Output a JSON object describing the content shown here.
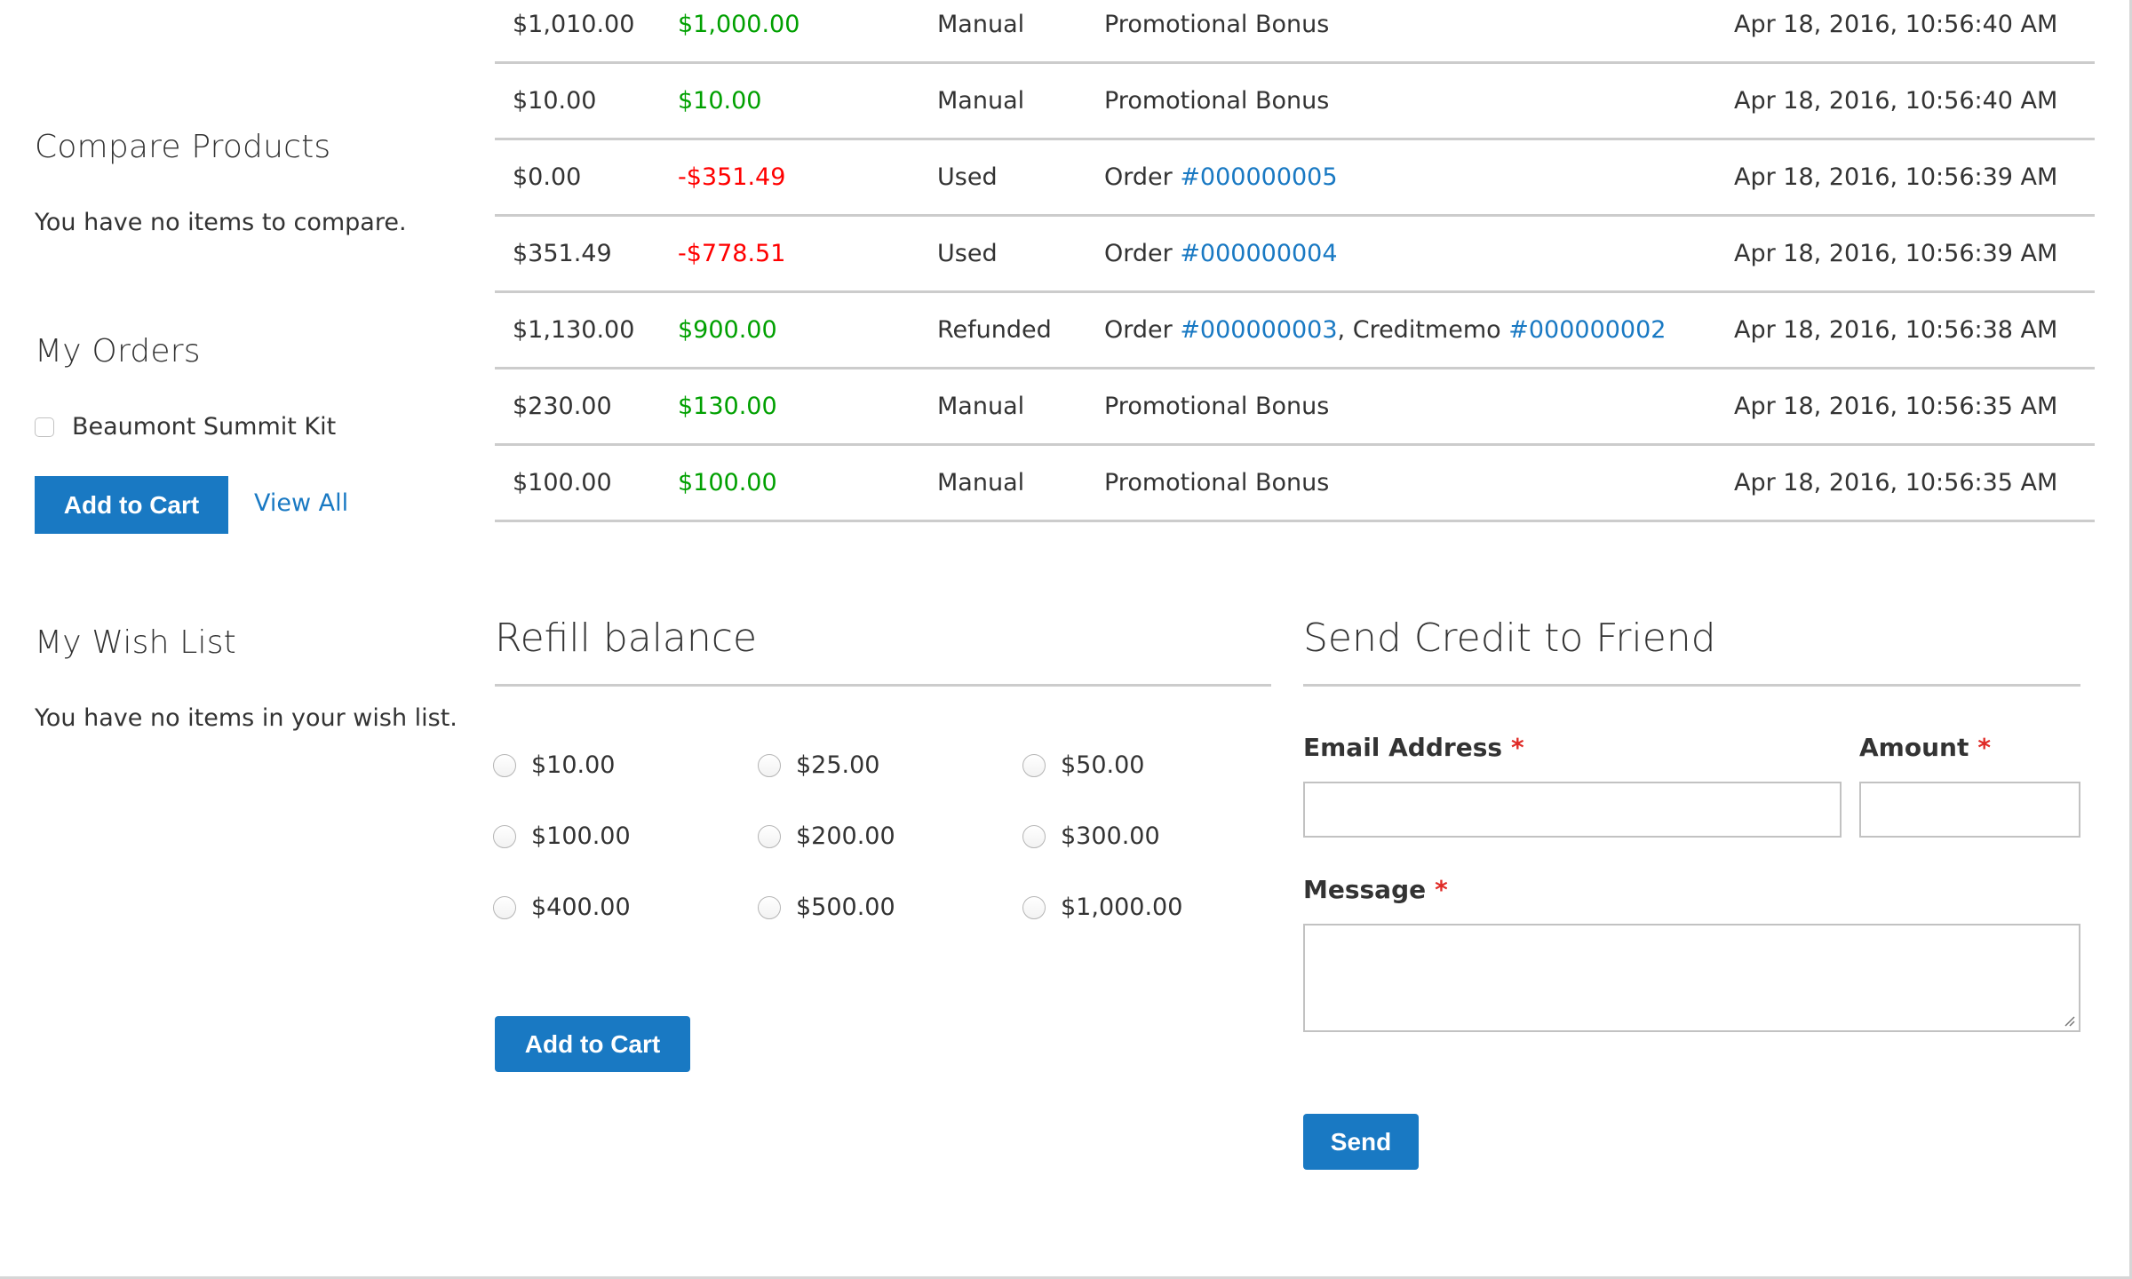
{
  "sidebar": {
    "compare": {
      "title": "Compare Products",
      "empty_text": "You have no items to compare."
    },
    "orders": {
      "title": "My Orders",
      "items": [
        {
          "label": "Beaumont Summit Kit",
          "checked": false
        }
      ],
      "add_to_cart_label": "Add to Cart",
      "view_all_label": "View All"
    },
    "wishlist": {
      "title": "My Wish List",
      "empty_text": "You have no items in your wish list."
    }
  },
  "history": {
    "rows": [
      {
        "balance": "$1,010.00",
        "change": "$1,000.00",
        "change_type": "positive",
        "action": "Manual",
        "info_text": "Promotional Bonus",
        "date": "Apr 18, 2016, 10:56:40 AM"
      },
      {
        "balance": "$10.00",
        "change": "$10.00",
        "change_type": "positive",
        "action": "Manual",
        "info_text": "Promotional Bonus",
        "date": "Apr 18, 2016, 10:56:40 AM"
      },
      {
        "balance": "$0.00",
        "change": "-$351.49",
        "change_type": "negative",
        "action": "Used",
        "info_prefix": "Order ",
        "info_link": "#000000005",
        "date": "Apr 18, 2016, 10:56:39 AM"
      },
      {
        "balance": "$351.49",
        "change": "-$778.51",
        "change_type": "negative",
        "action": "Used",
        "info_prefix": "Order ",
        "info_link": "#000000004",
        "date": "Apr 18, 2016, 10:56:39 AM"
      },
      {
        "balance": "$1,130.00",
        "change": "$900.00",
        "change_type": "positive",
        "action": "Refunded",
        "info_prefix": "Order ",
        "info_link": "#000000003",
        "info_middle": ", Creditmemo ",
        "info_link2": "#000000002",
        "date": "Apr 18, 2016, 10:56:38 AM"
      },
      {
        "balance": "$230.00",
        "change": "$130.00",
        "change_type": "positive",
        "action": "Manual",
        "info_text": "Promotional Bonus",
        "date": "Apr 18, 2016, 10:56:35 AM"
      },
      {
        "balance": "$100.00",
        "change": "$100.00",
        "change_type": "positive",
        "action": "Manual",
        "info_text": "Promotional Bonus",
        "date": "Apr 18, 2016, 10:56:35 AM"
      }
    ]
  },
  "refill": {
    "title": "Refill balance",
    "options": [
      "$10.00",
      "$25.00",
      "$50.00",
      "$100.00",
      "$200.00",
      "$300.00",
      "$400.00",
      "$500.00",
      "$1,000.00"
    ],
    "selected": null,
    "add_to_cart_label": "Add to Cart"
  },
  "send_credit": {
    "title": "Send Credit to Friend",
    "email_label": "Email Address",
    "email_value": "",
    "amount_label": "Amount",
    "amount_value": "",
    "message_label": "Message",
    "message_value": "",
    "required_mark": "*",
    "send_label": "Send"
  },
  "colors": {
    "primary": "#1979c3",
    "positive": "#00a000",
    "negative": "#ff0000",
    "required": "#e02b27",
    "text": "#333333",
    "divider": "#cccccc"
  }
}
